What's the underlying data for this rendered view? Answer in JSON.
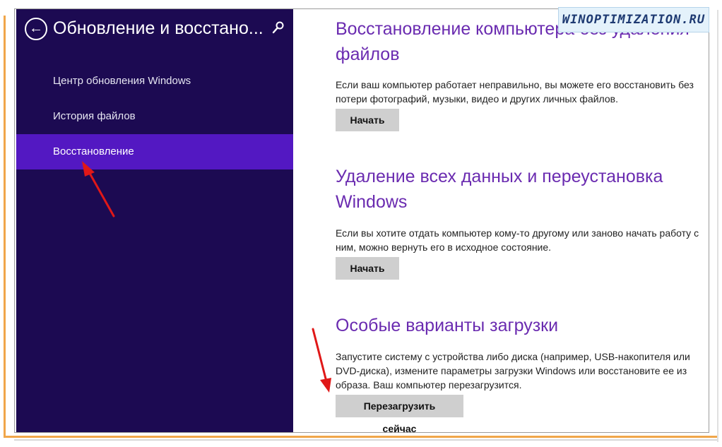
{
  "watermark": "WINOPTIMIZATION.RU",
  "sidebar": {
    "title": "Обновление и восстано...",
    "back_icon": "back-arrow-icon",
    "search_icon": "search-icon",
    "items": [
      {
        "label": "Центр обновления Windows",
        "active": false
      },
      {
        "label": "История файлов",
        "active": false
      },
      {
        "label": "Восстановление",
        "active": true
      }
    ]
  },
  "sections": [
    {
      "title": "Восстановление компьютера без удаления файлов",
      "description": "Если ваш компьютер работает неправильно, вы можете его восстановить без потери фотографий, музыки, видео и других личных файлов.",
      "button": "Начать"
    },
    {
      "title": "Удаление всех данных и переустановка Windows",
      "description": "Если вы хотите отдать компьютер кому-то другому или заново начать работу с ним, можно вернуть его в исходное состояние.",
      "button": "Начать"
    },
    {
      "title": "Особые варианты загрузки",
      "description": "Запустите систему с устройства либо диска (например, USB-накопителя или DVD-диска), измените параметры загрузки Windows или восстановите ее из образа. Ваш компьютер перезагрузится.",
      "button": "Перезагрузить сейчас"
    }
  ],
  "colors": {
    "sidebar_bg": "#1c0a52",
    "sidebar_active": "#5318c2",
    "heading": "#6a2bb0",
    "annotation_arrow": "#e01818"
  }
}
